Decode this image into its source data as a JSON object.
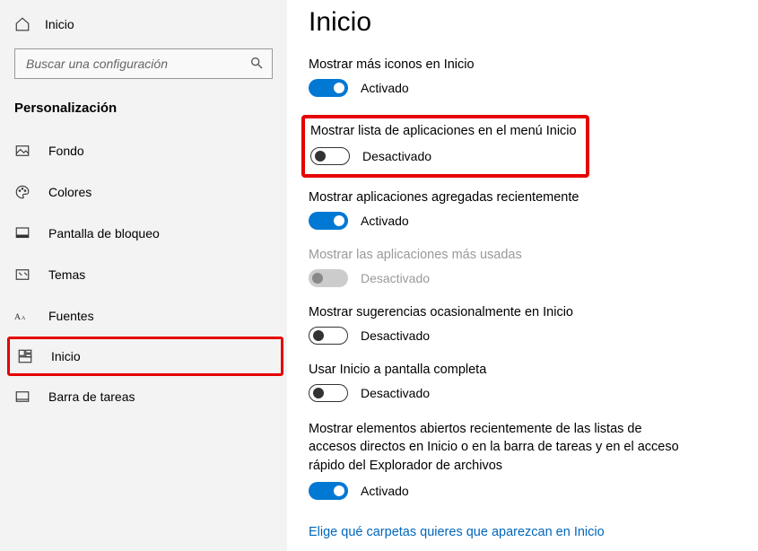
{
  "sidebar": {
    "home_label": "Inicio",
    "search_placeholder": "Buscar una configuración",
    "section_title": "Personalización",
    "items": [
      {
        "label": "Fondo"
      },
      {
        "label": "Colores"
      },
      {
        "label": "Pantalla de bloqueo"
      },
      {
        "label": "Temas"
      },
      {
        "label": "Fuentes"
      },
      {
        "label": "Inicio"
      },
      {
        "label": "Barra de tareas"
      }
    ]
  },
  "main": {
    "title": "Inicio",
    "settings": [
      {
        "label": "Mostrar más iconos en Inicio",
        "state": "Activado"
      },
      {
        "label": "Mostrar lista de aplicaciones en el menú Inicio",
        "state": "Desactivado"
      },
      {
        "label": "Mostrar aplicaciones agregadas recientemente",
        "state": "Activado"
      },
      {
        "label": "Mostrar las aplicaciones más usadas",
        "state": "Desactivado"
      },
      {
        "label": "Mostrar sugerencias ocasionalmente en Inicio",
        "state": "Desactivado"
      },
      {
        "label": "Usar Inicio a pantalla completa",
        "state": "Desactivado"
      },
      {
        "label": "Mostrar elementos abiertos recientemente de las listas de accesos directos en Inicio o en la barra de tareas y en el acceso rápido del Explorador de archivos",
        "state": "Activado"
      }
    ],
    "folder_link": "Elige qué carpetas quieres que aparezcan en Inicio"
  }
}
